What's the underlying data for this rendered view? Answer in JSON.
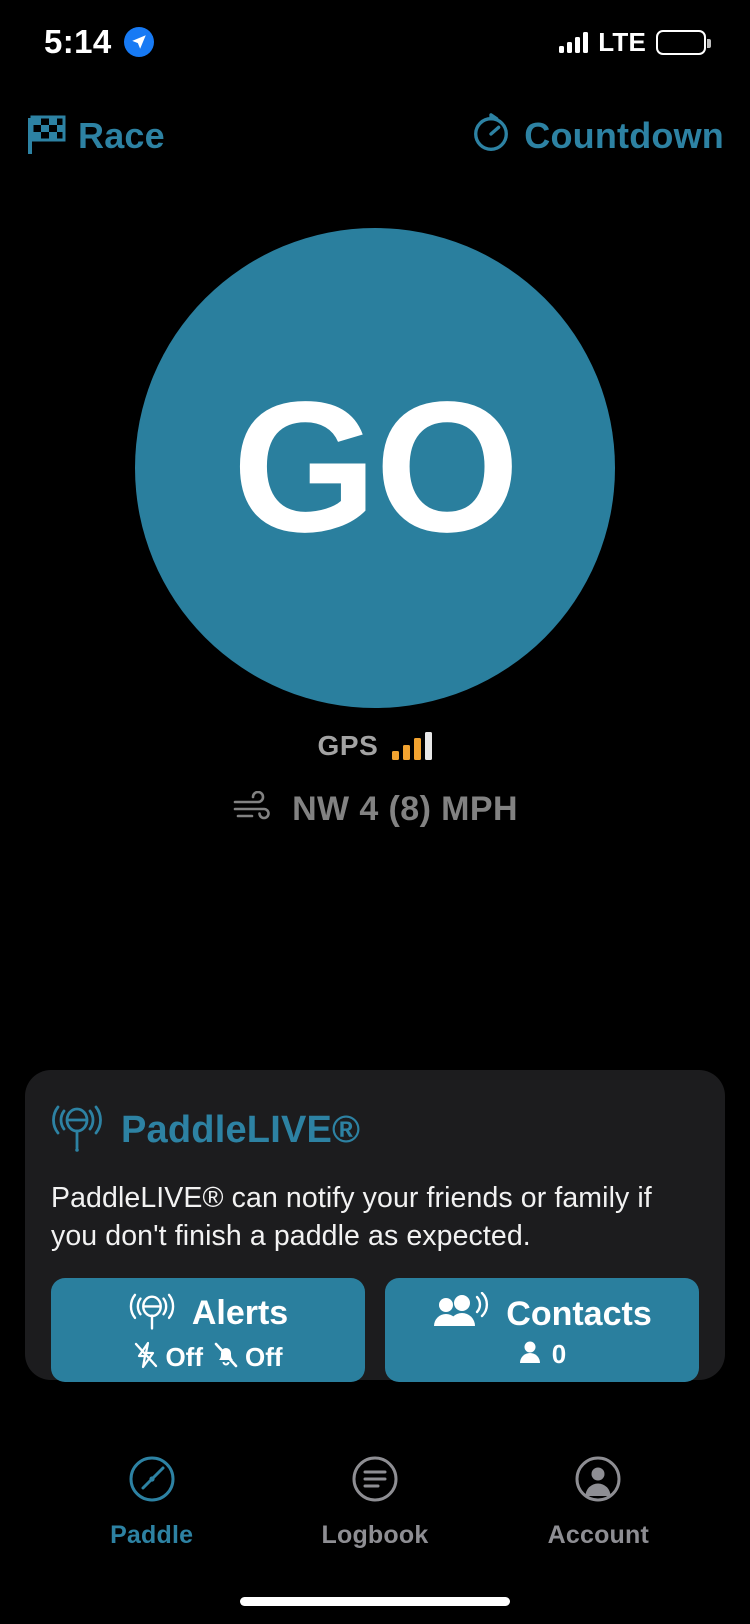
{
  "status_bar": {
    "time": "5:14",
    "location_icon": "location-arrow-icon",
    "network": "LTE",
    "signal_icon": "cellular-signal-icon",
    "battery_icon": "battery-full-icon",
    "accent_blue": "#177AF4"
  },
  "header": {
    "race": {
      "label": "Race",
      "icon": "checkered-flag-icon"
    },
    "countdown": {
      "label": "Countdown",
      "icon": "stopwatch-icon"
    }
  },
  "main": {
    "go_button": {
      "label": "GO",
      "color": "#2A7F9E"
    },
    "gps": {
      "label": "GPS",
      "bars_filled": 3,
      "bars_total": 4,
      "bar_color": "#F2A330",
      "empty_bar_color": "#E8E8E8"
    },
    "wind": {
      "icon": "wind-icon",
      "text": "NW 4 (8) MPH"
    }
  },
  "paddlelive_card": {
    "icon": "paddlelive-beacon-icon",
    "title": "PaddleLIVE®",
    "description": "PaddleLIVE® can notify your friends or family if you don't finish a paddle as expected.",
    "alerts_button": {
      "icon": "paddlelive-beacon-icon",
      "label": "Alerts",
      "flash_icon": "flash-off-icon",
      "flash_value": "Off",
      "bell_icon": "bell-off-icon",
      "bell_value": "Off"
    },
    "contacts_button": {
      "icon": "contacts-broadcast-icon",
      "label": "Contacts",
      "person_icon": "person-icon",
      "count": "0"
    }
  },
  "tab_bar": {
    "tabs": [
      {
        "label": "Paddle",
        "icon": "paddle-icon",
        "active": true
      },
      {
        "label": "Logbook",
        "icon": "logbook-icon",
        "active": false
      },
      {
        "label": "Account",
        "icon": "account-icon",
        "active": false
      }
    ],
    "active_color": "#2D82A3",
    "inactive_color": "#8E8E93"
  }
}
